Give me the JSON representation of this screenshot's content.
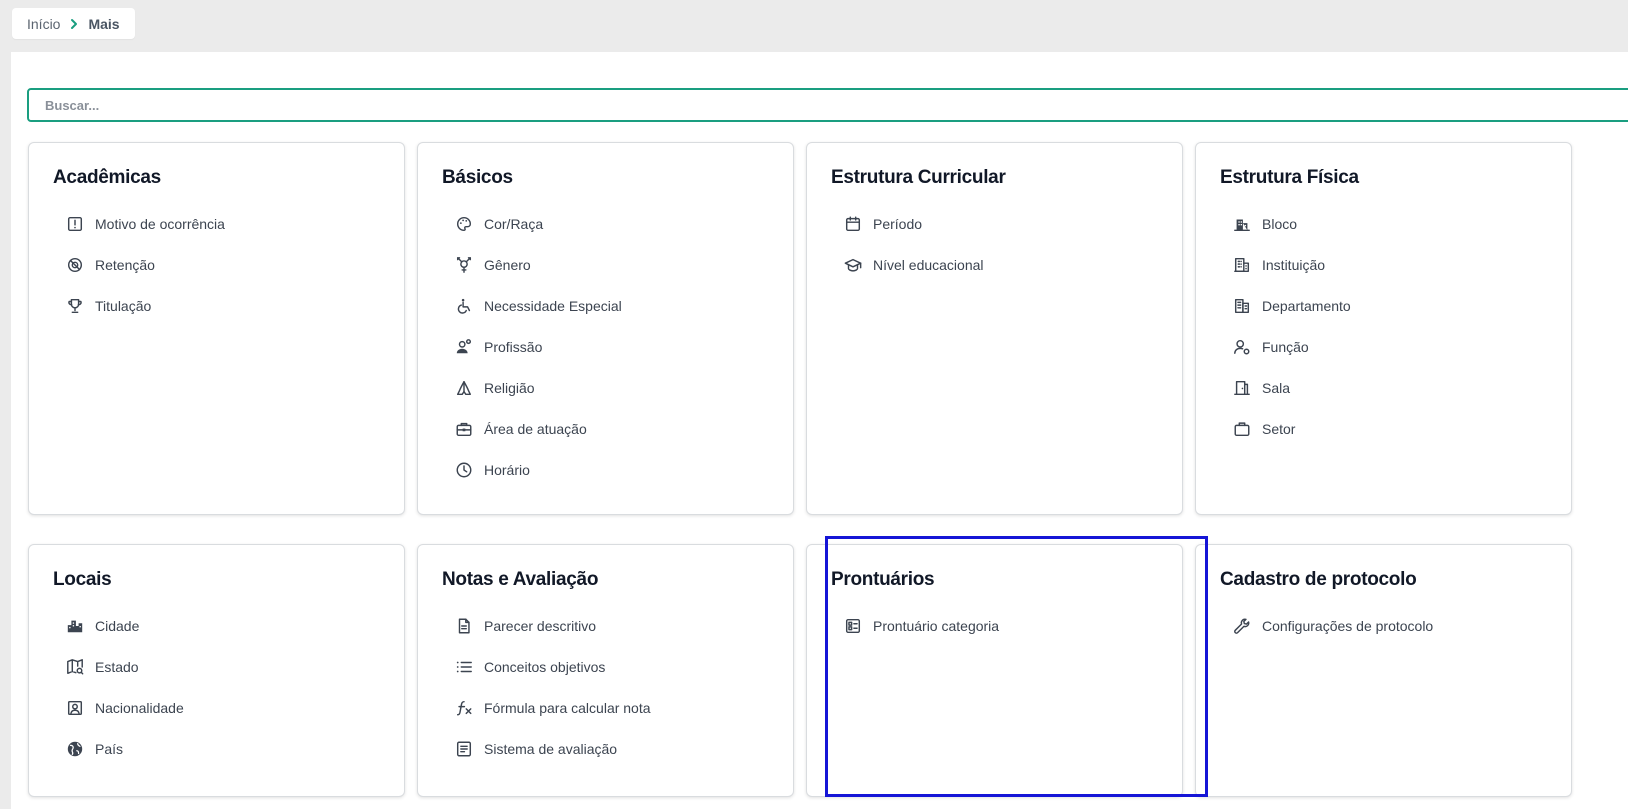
{
  "breadcrumb": {
    "home": "Início",
    "current": "Mais"
  },
  "search": {
    "placeholder": "Buscar..."
  },
  "cards": [
    {
      "title": "Acadêmicas",
      "items": [
        {
          "label": "Motivo de ocorrência",
          "icon": "alert-box-icon"
        },
        {
          "label": "Retenção",
          "icon": "block-icon"
        },
        {
          "label": "Titulação",
          "icon": "trophy-icon"
        }
      ]
    },
    {
      "title": "Básicos",
      "items": [
        {
          "label": "Cor/Raça",
          "icon": "palette-icon"
        },
        {
          "label": "Gênero",
          "icon": "gender-icon"
        },
        {
          "label": "Necessidade Especial",
          "icon": "accessibility-icon"
        },
        {
          "label": "Profissão",
          "icon": "worker-icon"
        },
        {
          "label": "Religião",
          "icon": "praying-hands-icon"
        },
        {
          "label": "Área de atuação",
          "icon": "toolbox-icon"
        },
        {
          "label": "Horário",
          "icon": "clock-icon"
        }
      ]
    },
    {
      "title": "Estrutura Curricular",
      "items": [
        {
          "label": "Período",
          "icon": "calendar-icon"
        },
        {
          "label": "Nível educacional",
          "icon": "graduation-cap-icon"
        }
      ]
    },
    {
      "title": "Estrutura Física",
      "items": [
        {
          "label": "Bloco",
          "icon": "buildings-icon"
        },
        {
          "label": "Instituição",
          "icon": "building-icon"
        },
        {
          "label": "Departamento",
          "icon": "office-icon"
        },
        {
          "label": "Função",
          "icon": "user-gear-icon"
        },
        {
          "label": "Sala",
          "icon": "door-icon"
        },
        {
          "label": "Setor",
          "icon": "briefcase-icon"
        }
      ]
    },
    {
      "title": "Locais",
      "items": [
        {
          "label": "Cidade",
          "icon": "city-icon"
        },
        {
          "label": "Estado",
          "icon": "map-search-icon"
        },
        {
          "label": "Nacionalidade",
          "icon": "id-portrait-icon"
        },
        {
          "label": "País",
          "icon": "globe-icon"
        }
      ]
    },
    {
      "title": "Notas e Avaliação",
      "items": [
        {
          "label": "Parecer descritivo",
          "icon": "document-icon"
        },
        {
          "label": "Conceitos objetivos",
          "icon": "list-icon"
        },
        {
          "label": "Fórmula para calcular nota",
          "icon": "function-icon"
        },
        {
          "label": "Sistema de avaliação",
          "icon": "article-icon"
        }
      ]
    },
    {
      "title": "Prontuários",
      "items": [
        {
          "label": "Prontuário categoria",
          "icon": "checklist-card-icon"
        }
      ]
    },
    {
      "title": "Cadastro de protocolo",
      "items": [
        {
          "label": "Configurações de protocolo",
          "icon": "wrench-icon"
        }
      ]
    }
  ],
  "colors": {
    "accent": "#1a9e80",
    "highlight": "#1515d6",
    "title": "#111827",
    "text": "#3c4450"
  }
}
